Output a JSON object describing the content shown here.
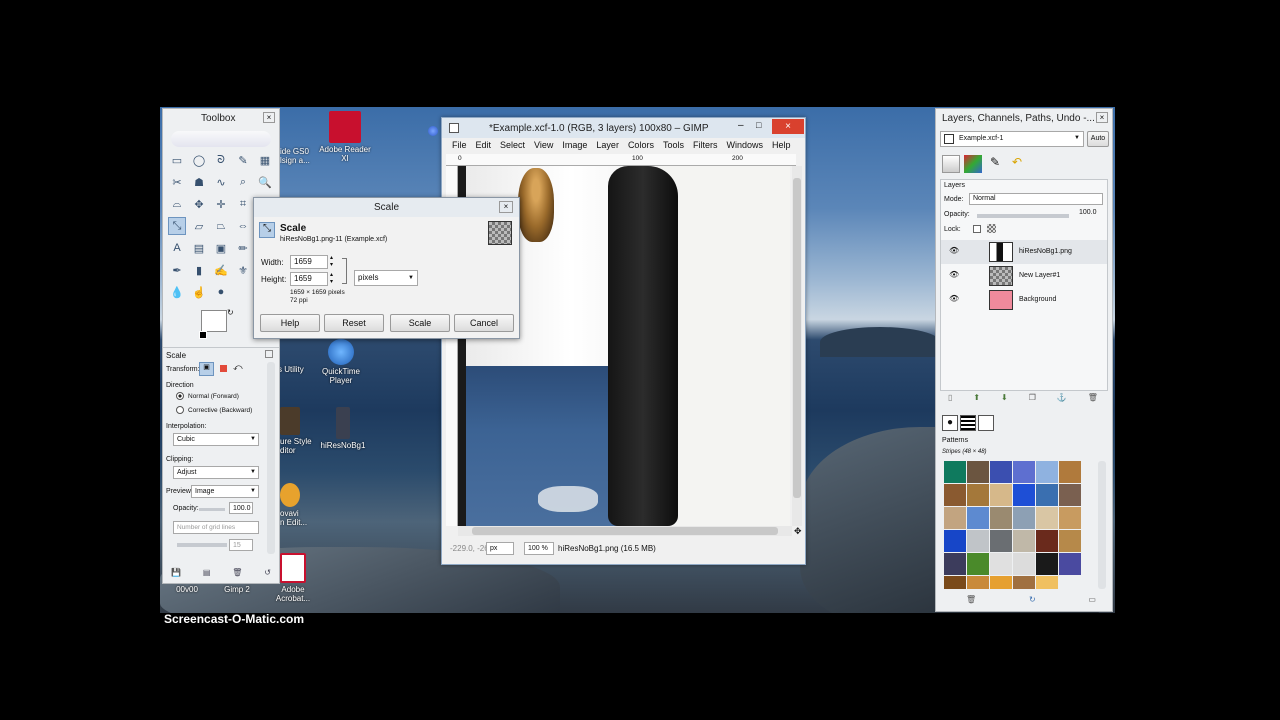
{
  "toolbox": {
    "title": "Toolbox",
    "tool_options": {
      "title": "Scale",
      "transform_label": "Transform:",
      "direction_label": "Direction",
      "direction_normal": "Normal (Forward)",
      "direction_corrective": "Corrective (Backward)",
      "interpolation_label": "Interpolation:",
      "interpolation_value": "Cubic",
      "clipping_label": "Clipping:",
      "clipping_value": "Adjust",
      "preview_label": "Preview:",
      "preview_value": "Image",
      "opacity_label": "Opacity:",
      "opacity_value": "100.0",
      "guides_value": "Number of grid lines",
      "grid_count": "15"
    }
  },
  "scale_dialog": {
    "title": "Scale",
    "heading": "Scale",
    "subheading": "hiResNoBg1.png-11 (Example.xcf)",
    "width_label": "Width:",
    "width_value": "1659",
    "height_label": "Height:",
    "height_value": "1659",
    "unit": "pixels",
    "size_info": "1659 × 1659 pixels",
    "ppi_info": "72 ppi",
    "help_button": "Help",
    "reset_button": "Reset",
    "scale_button": "Scale",
    "cancel_button": "Cancel"
  },
  "image_window": {
    "title": "*Example.xcf-1.0 (RGB, 3 layers) 100x80 – GIMP",
    "menus": [
      "File",
      "Edit",
      "Select",
      "View",
      "Image",
      "Layer",
      "Colors",
      "Tools",
      "Filters",
      "Windows",
      "Help"
    ],
    "ruler_labels": [
      "0",
      "100",
      "200"
    ],
    "coords": "-229.0, -26",
    "unit": "px",
    "zoom": "100 %",
    "status": "hiResNoBg1.png (16.5 MB)"
  },
  "layers_panel": {
    "title": "Layers, Channels, Paths, Undo -...",
    "image_select": "Example.xcf-1",
    "auto_button": "Auto",
    "section_title": "Layers",
    "mode_label": "Mode:",
    "mode_value": "Normal",
    "opacity_label": "Opacity:",
    "opacity_value": "100.0",
    "lock_label": "Lock:",
    "layers": [
      {
        "name": "hiResNoBg1.png"
      },
      {
        "name": "New Layer#1"
      },
      {
        "name": "Background"
      }
    ],
    "patterns_title": "Patterns",
    "patterns_subtitle": "Stripes (48 × 48)"
  },
  "desktop_icons": [
    {
      "label": "Adobe Reader XI"
    },
    {
      "label": "QuickTime Player"
    },
    {
      "label": "hiResNoBg1"
    },
    {
      "label": "Adobe Acrobat..."
    },
    {
      "label": "Gimp 2"
    }
  ],
  "desktop_partial_labels": {
    "gs": "ide GS0\nlsign a...",
    "utility": "s Utility",
    "style": "ure Style\nditor",
    "movavi": "ovavi\nn Edit...",
    "bottom_left": "00v00"
  },
  "watermark": "Screencast-O-Matic.com",
  "colors": {
    "background_layer_thumb": "#f08a9c",
    "accent_close": "#d9412e",
    "panel_bg": "#eef0f2"
  }
}
